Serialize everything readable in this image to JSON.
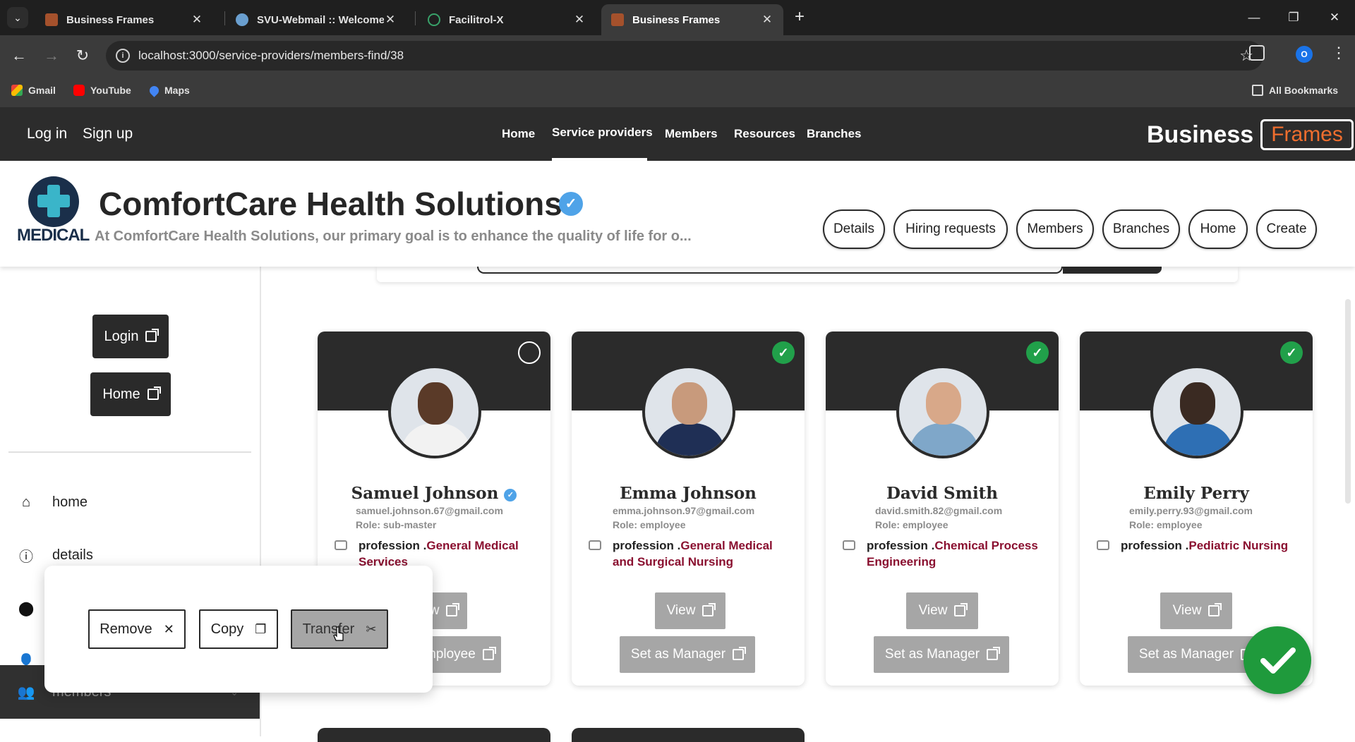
{
  "browser": {
    "tabs": [
      {
        "title": "Business Frames",
        "active": false
      },
      {
        "title": "SVU-Webmail :: Welcome",
        "active": false
      },
      {
        "title": "Facilitrol-X",
        "active": false
      },
      {
        "title": "Business Frames",
        "active": true
      }
    ],
    "url": "localhost:3000/service-providers/members-find/38",
    "profile_initial": "O",
    "bookmarks": [
      "Gmail",
      "YouTube",
      "Maps"
    ],
    "all_bookmarks": "All Bookmarks"
  },
  "site_nav": {
    "login": "Log in",
    "signup": "Sign up",
    "links": [
      "Home",
      "Service providers",
      "Members",
      "Resources",
      "Branches"
    ],
    "active_link": "Service providers",
    "brand_a": "Business",
    "brand_b": "Frames",
    "brand_color": "#f06e2e"
  },
  "company": {
    "logo_text": "MEDICAL",
    "name": "ComfortCare Health Solutions",
    "tagline": "At ComfortCare Health Solutions, our primary goal is to enhance the quality of life for o...",
    "tabs": [
      "Details",
      "Hiring requests",
      "Members",
      "Branches",
      "Home",
      "Create"
    ]
  },
  "sidebar": {
    "login_button": "Login",
    "home_button": "Home",
    "items": [
      {
        "label": "home",
        "icon": "home-icon"
      },
      {
        "label": "details",
        "icon": "info-icon"
      },
      {
        "label": "",
        "icon": "location-icon"
      },
      {
        "label": "",
        "icon": "person-icon"
      },
      {
        "label": "members",
        "icon": "group-icon"
      }
    ]
  },
  "members": [
    {
      "name": "Samuel Johnson",
      "verified": true,
      "email": "samuel.johnson.67@gmail.com",
      "role": "Role: sub-master",
      "profession_prefix": "profession .",
      "profession": "General Medical Services",
      "selected": false,
      "view": "View",
      "action": "Set as Employee"
    },
    {
      "name": "Emma Johnson",
      "verified": false,
      "email": "emma.johnson.97@gmail.com",
      "role": "Role: employee",
      "profession_prefix": "profession .",
      "profession": "General Medical and Surgical Nursing",
      "selected": true,
      "view": "View",
      "action": "Set as Manager"
    },
    {
      "name": "David Smith",
      "verified": false,
      "email": "david.smith.82@gmail.com",
      "role": "Role: employee",
      "profession_prefix": "profession .",
      "profession": "Chemical Process Engineering",
      "selected": true,
      "view": "View",
      "action": "Set as Manager"
    },
    {
      "name": "Emily Perry",
      "verified": false,
      "email": "emily.perry.93@gmail.com",
      "role": "Role: employee",
      "profession_prefix": "profession .",
      "profession": "Pediatric Nursing",
      "selected": true,
      "view": "View",
      "action": "Set as Manager"
    }
  ],
  "popup": {
    "remove": "Remove",
    "copy": "Copy",
    "transfer": "Transfer"
  },
  "colors": {
    "accent_green": "#21a04a",
    "profession_text": "#8a1030"
  }
}
